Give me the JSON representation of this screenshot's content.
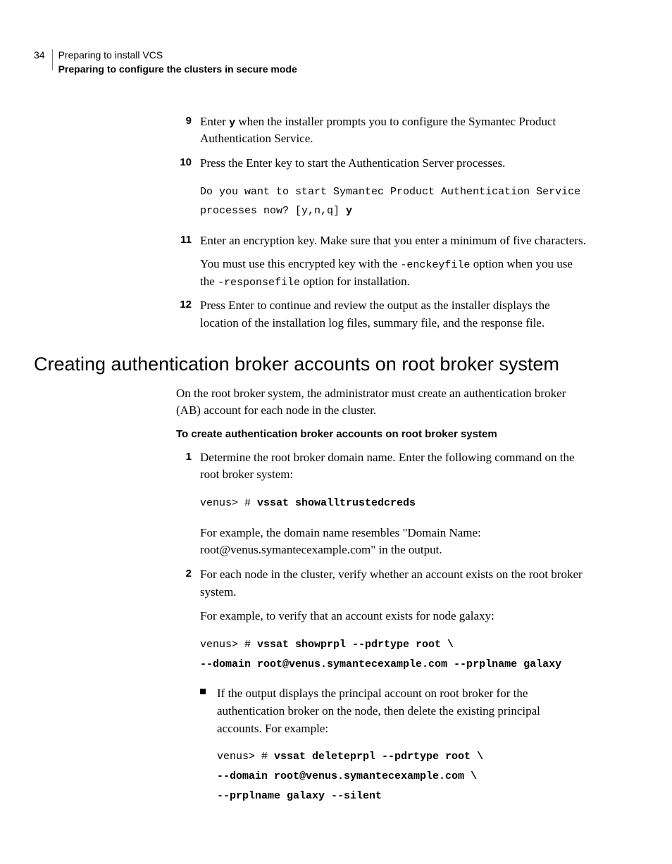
{
  "header": {
    "page_number": "34",
    "chapter": "Preparing to install VCS",
    "section": "Preparing to configure the clusters in secure mode"
  },
  "steps_cont": {
    "s9": {
      "text_pre": "Enter ",
      "code_y": "y",
      "text_post": " when the installer prompts you to configure the Symantec Product Authentication Service."
    },
    "s10": {
      "text": "Press the Enter key to start the Authentication Server processes.",
      "code_line1": "Do you want to start Symantec Product Authentication Service",
      "code_line2_pre": "processes now? [y,n,q] ",
      "code_line2_b": "y"
    },
    "s11": {
      "p1": "Enter an encryption key. Make sure that you enter a minimum of five characters.",
      "p2_pre": "You must use this encrypted key with the ",
      "p2_c1": "-enckeyfile",
      "p2_mid": " option when you use the ",
      "p2_c2": "-responsefile",
      "p2_post": " option for installation."
    },
    "s12": {
      "text": "Press Enter to continue and review the output as the installer displays the location of the installation log files, summary file, and the response file."
    }
  },
  "section2": {
    "heading": "Creating authentication broker accounts on root broker system",
    "intro": "On the root broker system, the administrator must create an authentication broker (AB) account for each node in the cluster.",
    "proc_title": "To create authentication broker accounts on root broker system",
    "s1": {
      "p1": "Determine the root broker domain name. Enter the following command on the root broker system:",
      "code_pre": "venus> # ",
      "code_b": "vssat showalltrustedcreds",
      "p2": "For example, the domain name resembles \"Domain Name: root@venus.symantecexample.com\" in the output."
    },
    "s2": {
      "p1": "For each node in the cluster, verify whether an account exists on the root broker system.",
      "p2": "For example, to verify that an account exists for node galaxy:",
      "code1_pre": "venus> # ",
      "code1_b": "vssat showprpl --pdrtype root \\",
      "code2_b": "--domain root@venus.symantecexample.com --prplname galaxy",
      "sub1": {
        "text": "If the output displays the principal account on root broker for the authentication broker on the node, then delete the existing principal accounts. For example:",
        "c1_pre": "venus> # ",
        "c1_b": "vssat deleteprpl --pdrtype root \\",
        "c2_b": "--domain root@venus.symantecexample.com \\",
        "c3_b": "--prplname galaxy --silent"
      }
    }
  }
}
